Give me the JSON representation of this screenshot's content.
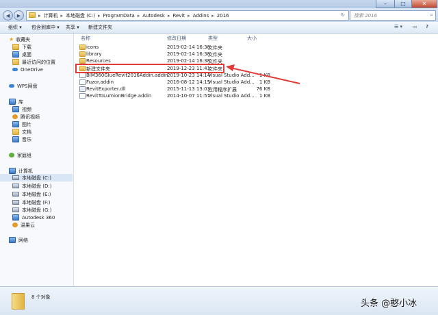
{
  "window": {
    "minimize_glyph": "–",
    "maximize_glyph": "□",
    "close_glyph": "✕"
  },
  "nav": {
    "back_glyph": "◀",
    "forward_glyph": "▶",
    "breadcrumb": [
      "计算机",
      "本地磁盘 (C:)",
      "ProgramData",
      "Autodesk",
      "Revit",
      "Addins",
      "2016"
    ],
    "separator": "▸",
    "refresh_glyph": "↻",
    "search_placeholder": "搜索 2016",
    "search_glyph": "⌕"
  },
  "toolbar": {
    "organize": "组织 ▾",
    "include_library": "包含到库中 ▾",
    "share": "共享 ▾",
    "new_folder": "新建文件夹",
    "view_glyph": "☰ ▾",
    "pane_glyph": "▭",
    "help_glyph": "?"
  },
  "sidebar": {
    "favorites": "收藏夹",
    "downloads": "下载",
    "desktop": "桌面",
    "recent": "最近访问的位置",
    "onedrive": "OneDrive",
    "wps": "WPS网盘",
    "libraries": "库",
    "videos": "视频",
    "tencent_video": "腾讯视频",
    "pictures": "图片",
    "documents": "文档",
    "music": "音乐",
    "homegroup": "家庭组",
    "computer": "计算机",
    "drives": [
      "本地磁盘 (C:)",
      "本地磁盘 (D:)",
      "本地磁盘 (E:)",
      "本地磁盘 (F:)",
      "本地磁盘 (G:)"
    ],
    "autodesk360": "Autodesk 360",
    "cloud": "温果云",
    "network": "网络"
  },
  "columns": {
    "name": "名称",
    "date": "修改日期",
    "type": "类型",
    "size": "大小"
  },
  "files": [
    {
      "name": "icons",
      "date": "2019-02-14 16:38",
      "type": "文件夹",
      "size": "",
      "kind": "folder"
    },
    {
      "name": "library",
      "date": "2019-02-14 16:38",
      "type": "文件夹",
      "size": "",
      "kind": "folder"
    },
    {
      "name": "Resources",
      "date": "2019-02-14 16:38",
      "type": "文件夹",
      "size": "",
      "kind": "folder"
    },
    {
      "name": "新建文件夹",
      "date": "2019-12-23 11:41",
      "type": "文件夹",
      "size": "",
      "kind": "folder"
    },
    {
      "name": "BIM360GlueRevit2016Addin.addin",
      "date": "2019-10-23 14:14",
      "type": "Visual Studio Add...",
      "size": "1 KB",
      "kind": "file"
    },
    {
      "name": "Fuzor.addin",
      "date": "2016-08-12 14:15",
      "type": "Visual Studio Add...",
      "size": "1 KB",
      "kind": "file"
    },
    {
      "name": "RevitExporter.dll",
      "date": "2015-11-13 13:03",
      "type": "应用程序扩展",
      "size": "76 KB",
      "kind": "dll"
    },
    {
      "name": "RevitToLumionBridge.addin",
      "date": "2014-10-07 11:57",
      "type": "Visual Studio Add...",
      "size": "1 KB",
      "kind": "file"
    }
  ],
  "status": {
    "count": "8 个对象"
  },
  "watermark": "头条 @憨小冰"
}
